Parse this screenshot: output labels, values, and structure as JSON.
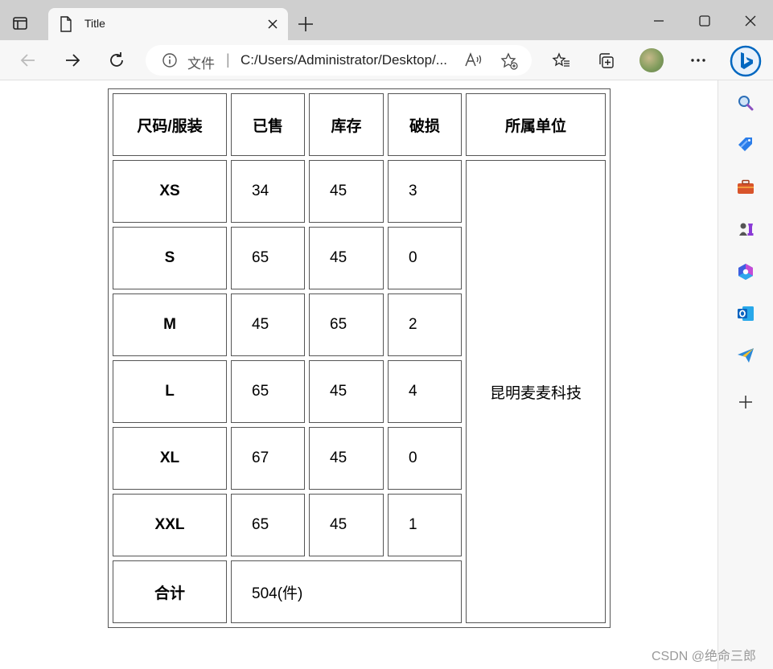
{
  "browser": {
    "tab": {
      "title": "Title"
    },
    "address": {
      "scheme_label": "文件",
      "separator": "|",
      "url": "C:/Users/Administrator/Desktop/..."
    }
  },
  "table": {
    "headers": [
      "尺码/服装",
      "已售",
      "库存",
      "破损",
      "所属单位"
    ],
    "rows": [
      {
        "size": "XS",
        "sold": "34",
        "stock": "45",
        "damaged": "3"
      },
      {
        "size": "S",
        "sold": "65",
        "stock": "45",
        "damaged": "0"
      },
      {
        "size": "M",
        "sold": "45",
        "stock": "65",
        "damaged": "2"
      },
      {
        "size": "L",
        "sold": "65",
        "stock": "45",
        "damaged": "4"
      },
      {
        "size": "XL",
        "sold": "67",
        "stock": "45",
        "damaged": "0"
      },
      {
        "size": "XXL",
        "sold": "65",
        "stock": "45",
        "damaged": "1"
      }
    ],
    "unit": "昆明麦麦科技",
    "total_label": "合计",
    "total_value": "504(件)"
  },
  "watermark": "CSDN @绝命三郎",
  "colors": {
    "accent_blue": "#0067c0",
    "tabstrip": "#cfcfcf",
    "toolbar": "#f7f7f7"
  }
}
